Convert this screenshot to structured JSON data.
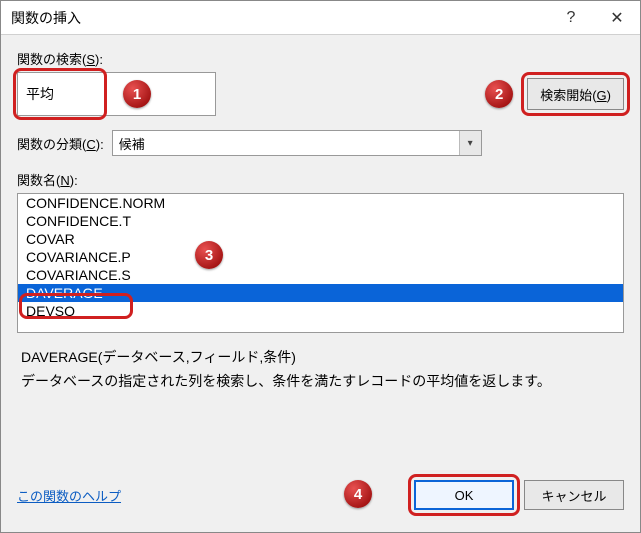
{
  "titlebar": {
    "title": "関数の挿入"
  },
  "search": {
    "label_pre": "関数の検索(",
    "label_ak": "S",
    "label_post": "):",
    "value": "平均",
    "button_pre": "検索開始(",
    "button_ak": "G",
    "button_post": ")"
  },
  "category": {
    "label_pre": "関数の分類(",
    "label_ak": "C",
    "label_post": "):",
    "selected": "候補"
  },
  "function_list": {
    "label_pre": "関数名(",
    "label_ak": "N",
    "label_post": "):",
    "items": [
      "CONFIDENCE.NORM",
      "CONFIDENCE.T",
      "COVAR",
      "COVARIANCE.P",
      "COVARIANCE.S",
      "DAVERAGE",
      "DEVSQ"
    ],
    "selected_index": 5
  },
  "detail": {
    "signature": "DAVERAGE(データベース,フィールド,条件)",
    "description": "データベースの指定された列を検索し、条件を満たすレコードの平均値を返します。"
  },
  "footer": {
    "help_link": "この関数のヘルプ",
    "ok": "OK",
    "cancel": "キャンセル"
  },
  "annotations": {
    "b1": "1",
    "b2": "2",
    "b3": "3",
    "b4": "4"
  }
}
